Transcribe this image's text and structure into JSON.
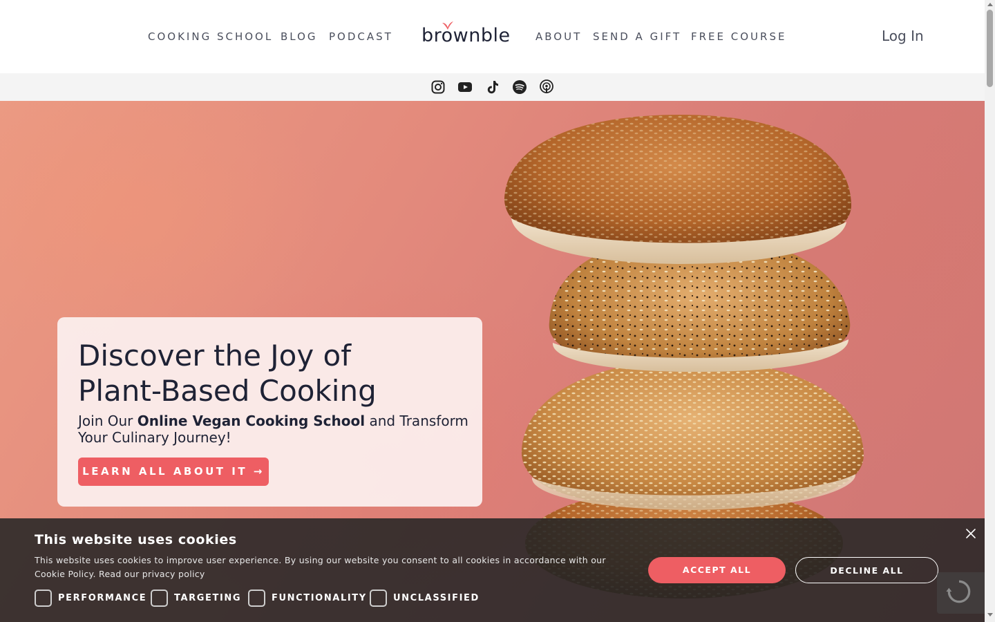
{
  "nav": {
    "left": [
      "COOKING SCHOOL",
      "BLOG",
      "PODCAST"
    ],
    "right": [
      "ABOUT",
      "SEND A GIFT",
      "FREE COURSE"
    ],
    "logo": "brownble",
    "login": "Log In"
  },
  "social": {
    "icons": [
      "instagram-icon",
      "youtube-icon",
      "tiktok-icon",
      "spotify-icon",
      "podcast-icon"
    ]
  },
  "hero": {
    "title_line1": "Discover the Joy of",
    "title_line2": "Plant-Based Cooking",
    "sub_pre": "Join Our ",
    "sub_bold": "Online Vegan Cooking School",
    "sub_post": " and Transform Your Culinary Journey!",
    "cta": "LEARN ALL ABOUT IT →"
  },
  "cookie": {
    "title": "This website uses cookies",
    "text": "This website uses cookies to improve user experience. By using our website you consent to all cookies in accordance with our Cookie Policy. Read our privacy policy",
    "options": [
      "PERFORMANCE",
      "TARGETING",
      "FUNCTIONALITY",
      "UNCLASSIFIED"
    ],
    "accept": "ACCEPT ALL",
    "decline": "DECLINE ALL"
  },
  "colors": {
    "accent": "#ee5e63",
    "text": "#1e2235",
    "nav_text": "#4a4e5c",
    "hero_bg": "#e38a7c"
  }
}
